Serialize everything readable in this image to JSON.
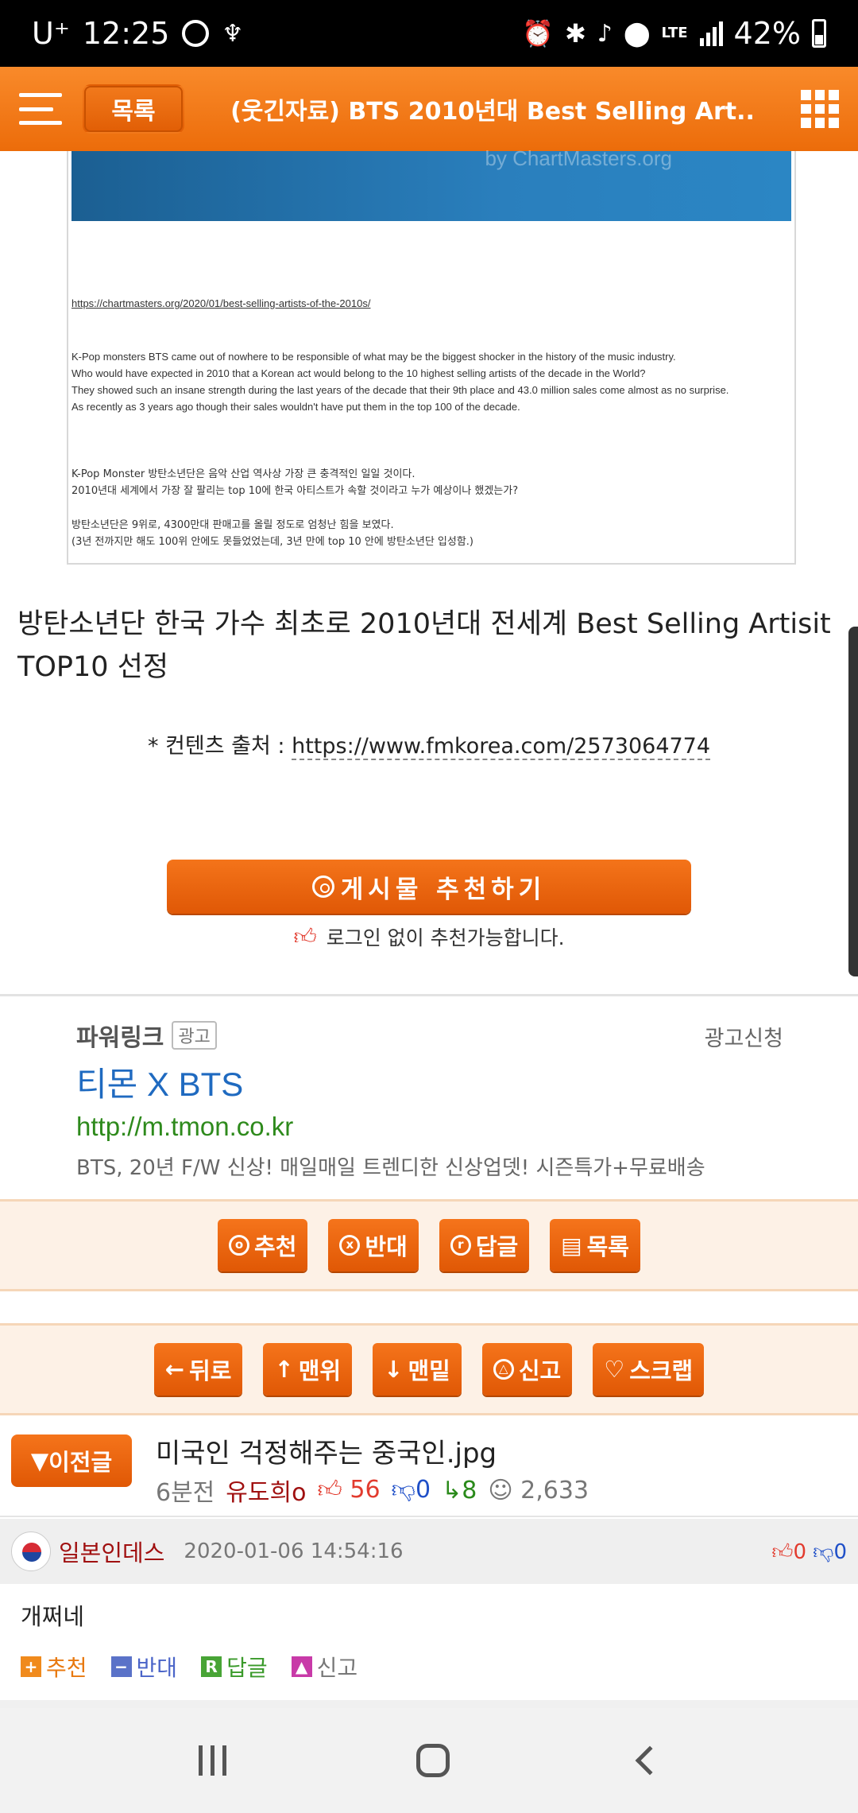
{
  "status_bar": {
    "carrier": "U⁺",
    "time": "12:25",
    "network": "LTE",
    "battery": "42%"
  },
  "appbar": {
    "list_label": "목록",
    "title": "(웃긴자료) BTS 2010년대 Best Selling Art.."
  },
  "article_image": {
    "link": "https://chartmasters.org/2020/01/best-selling-artists-of-the-2010s/",
    "english_lines": [
      "K-Pop monsters BTS came out of nowhere to be responsible of what may be the biggest shocker in the history of the music industry.",
      "Who would have expected in 2010 that a Korean act would belong to the 10 highest selling artists of the decade in the World?",
      "They showed such an insane strength during the last years of the decade that their 9th place and 43.0 million sales come almost as no surprise.",
      "As recently as 3 years ago though their sales wouldn't have put them in the top 100 of the decade."
    ],
    "korean_lines_1": [
      "K-Pop Monster 방탄소년단은 음악 산업 역사상 가장 큰 충격적인 일일 것이다.",
      "2010년대 세계에서 가장 잘 팔리는 top 10에 한국 아티스트가 속할 것이라고 누가 예상이나 했겠는가?"
    ],
    "korean_lines_2": [
      "방탄소년단은 9위로, 4300만대 판매고를 올릴 정도로 엄청난 힘을 보였다.",
      "(3년 전까지만 해도 100위 안에도 못들었었는데, 3년 만에 top 10 안에 방탄소년단 입성함.)"
    ]
  },
  "headline": "방탄소년단 한국 가수 최초로 2010년대 전세계 Best Selling Artisit TOP10 선정",
  "content_source": {
    "label": "* 컨텐츠 출처 : ",
    "url": "https://www.fmkorea.com/2573064774"
  },
  "recommend": {
    "button": "게시물 추천하기",
    "note": "로그인 없이 추천가능합니다."
  },
  "ad": {
    "powerlink": "파워링크",
    "tag": "광고",
    "apply": "광고신청",
    "title": "티몬 X BTS",
    "url": "http://m.tmon.co.kr",
    "desc": "BTS, 20년 F/W 신상! 매일매일 트렌디한 신상업뎃! 시즌특가+무료배송"
  },
  "action_bar_1": {
    "recommend": "추천",
    "oppose": "반대",
    "reply": "답글",
    "list": "목록"
  },
  "action_bar_2": {
    "back": "뒤로",
    "top": "맨위",
    "bottom": "맨밑",
    "report": "신고",
    "scrap": "스크랩"
  },
  "prev_post": {
    "button": "이전글",
    "title": "미국인 걱정해주는 중국인.jpg",
    "time": "6분전",
    "author": "유도희o",
    "upvotes": "56",
    "downvotes": "0",
    "replies": "8",
    "views": "2,633"
  },
  "comment": {
    "nickname": "일본인데스",
    "date": "2020-01-06 14:54:16",
    "up": "0",
    "down": "0",
    "body": "개쩌네",
    "actions": {
      "recommend": "추천",
      "oppose": "반대",
      "reply": "답글",
      "report": "신고"
    }
  },
  "colors": {
    "accent": "#ec6c0a",
    "ad_title": "#1f6ac0",
    "ad_url": "#2e8a1c"
  }
}
